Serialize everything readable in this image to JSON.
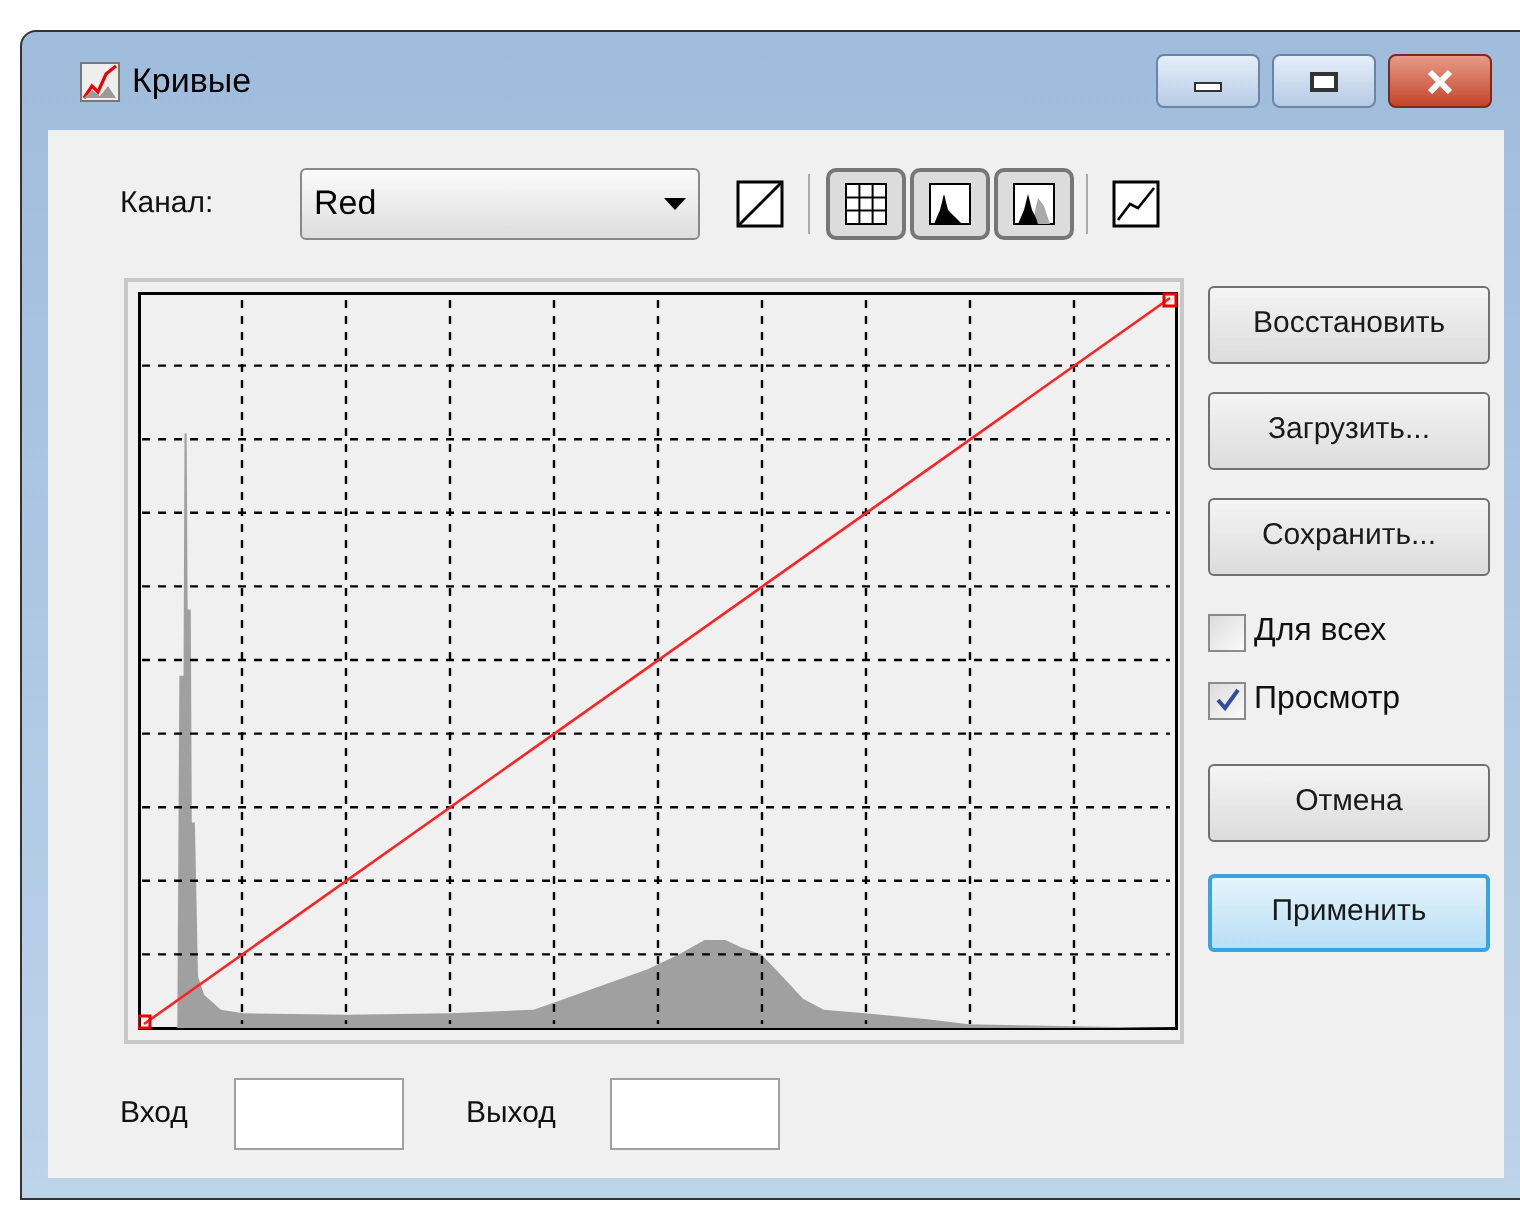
{
  "window": {
    "title": "Кривые"
  },
  "toolbar": {
    "channel_label": "Канал:",
    "channel_value": "Red"
  },
  "buttons": [
    {
      "label": "Восстановить",
      "default": false
    },
    {
      "label": "Загрузить...",
      "default": false
    },
    {
      "label": "Сохранить...",
      "default": false
    }
  ],
  "options": [
    {
      "label": "Для всех",
      "checked": false
    },
    {
      "label": "Просмотр",
      "checked": true
    }
  ],
  "actions": [
    {
      "label": "Отмена",
      "default": false
    },
    {
      "label": "Применить",
      "default": true
    }
  ],
  "fields": [
    {
      "label": "Вход"
    },
    {
      "label": "Выход"
    }
  ]
}
